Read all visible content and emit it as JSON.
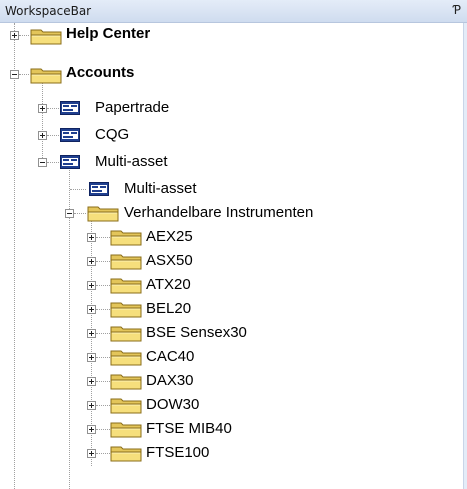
{
  "panel": {
    "title": "WorkspaceBar",
    "pin_icon": "pin-icon"
  },
  "tree": {
    "help_center": "Help Center",
    "accounts": "Accounts",
    "papertrade": "Papertrade",
    "cqg": "CQG",
    "multi_asset": "Multi-asset",
    "multi_asset_child": "Multi-asset",
    "instrumenten": "Verhandelbare Instrumenten",
    "instruments": [
      "AEX25",
      "ASX50",
      "ATX20",
      "BEL20",
      "BSE Sensex30",
      "CAC40",
      "DAX30",
      "DOW30",
      "FTSE MIB40",
      "FTSE100"
    ]
  }
}
